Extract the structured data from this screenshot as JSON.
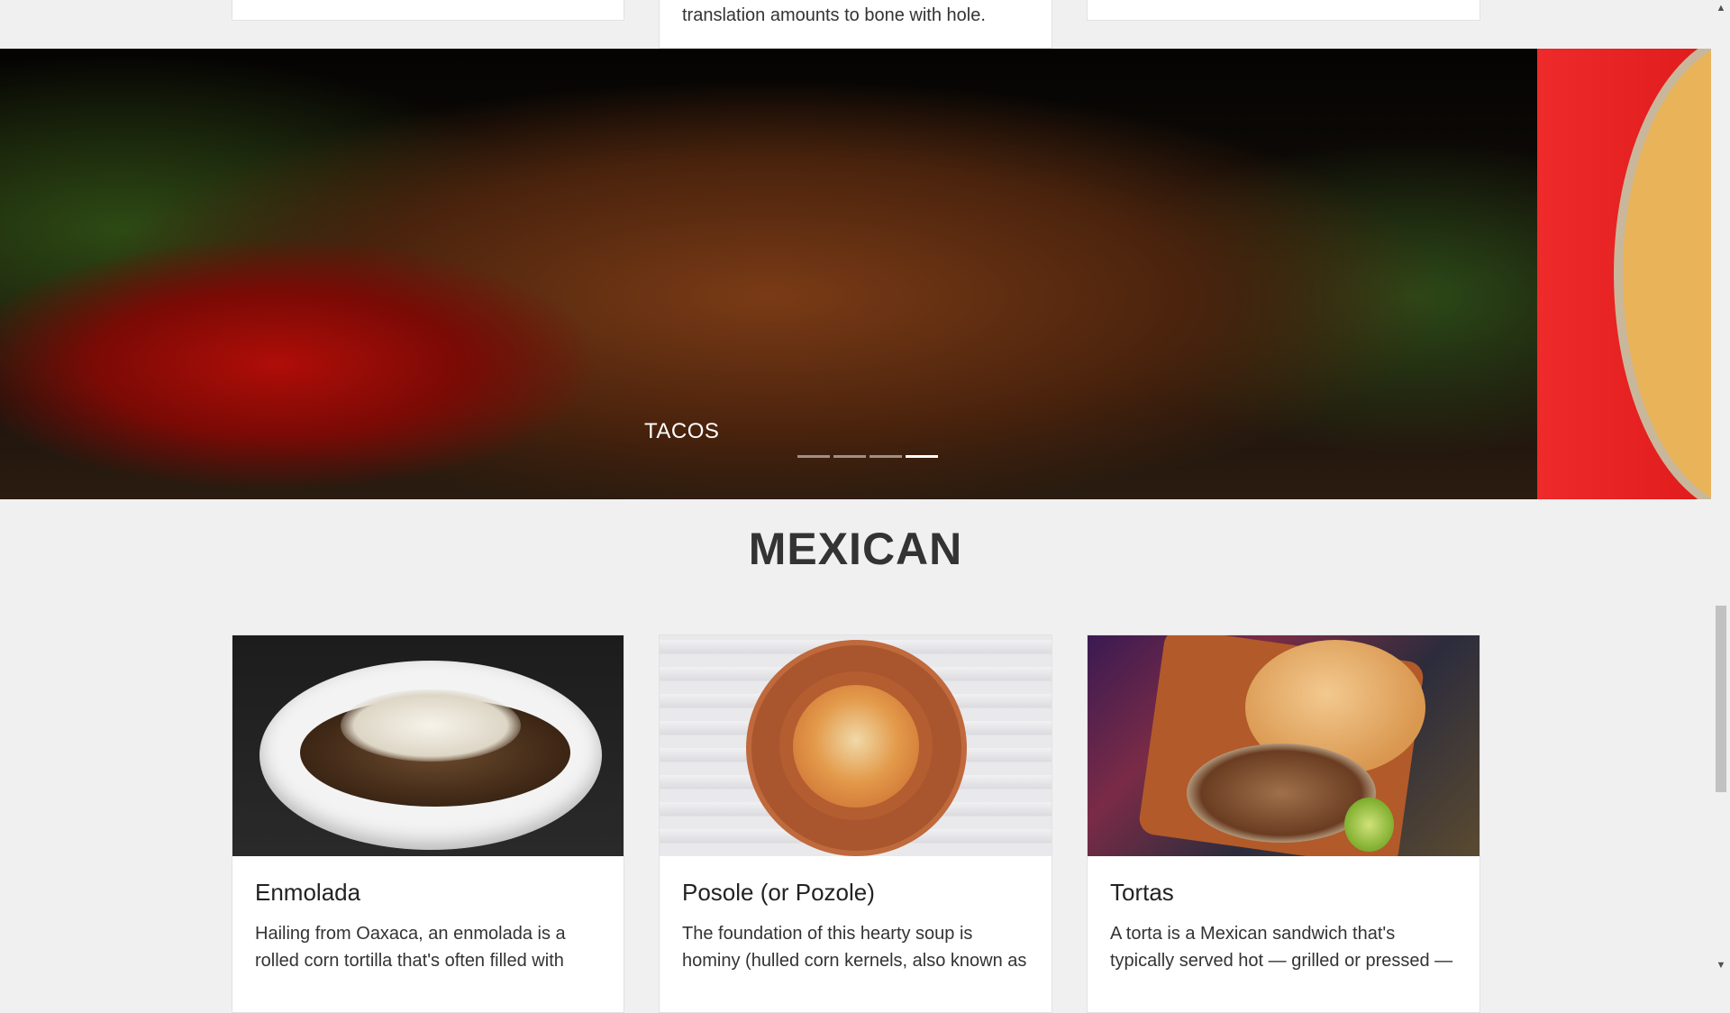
{
  "top_cards": {
    "middle_text": "translation amounts to bone with hole."
  },
  "carousel": {
    "caption": "TACOS",
    "indicator_count": 4,
    "active_index": 3
  },
  "section": {
    "title": "MEXICAN"
  },
  "recipes": [
    {
      "title": "Enmolada",
      "description": "Hailing from Oaxaca, an enmolada is a rolled corn tortilla that's often filled with"
    },
    {
      "title": "Posole (or Pozole)",
      "description": "The foundation of this hearty soup is hominy (hulled corn kernels, also known as"
    },
    {
      "title": "Tortas",
      "description": "A torta is a Mexican sandwich that's typically served hot — grilled or pressed —"
    }
  ],
  "scrollbar": {
    "up_icon": "▲",
    "down_icon": "▼"
  }
}
